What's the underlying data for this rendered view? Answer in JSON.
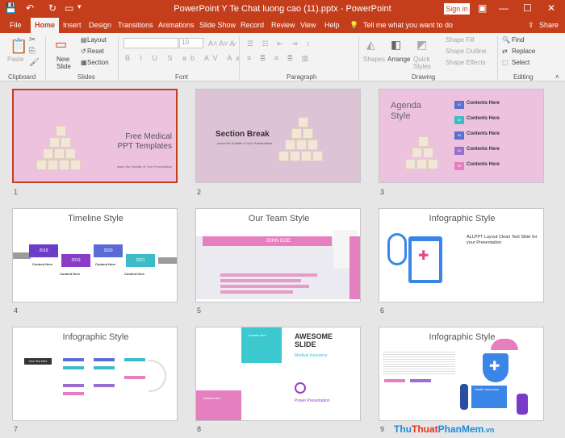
{
  "window": {
    "title": "PowerPoint Y Te Chat luong cao (11).pptx - PowerPoint",
    "sign_in": "Sign in",
    "share": "Share",
    "tell_me": "Tell me what you want to do"
  },
  "tabs": [
    "File",
    "Home",
    "Insert",
    "Design",
    "Transitions",
    "Animations",
    "Slide Show",
    "Record",
    "Review",
    "View",
    "Help"
  ],
  "ribbon": {
    "clipboard": {
      "label": "Clipboard",
      "paste": "Paste"
    },
    "slides": {
      "label": "Slides",
      "new_slide": "New Slide",
      "layout": "Layout",
      "reset": "Reset",
      "section": "Section"
    },
    "font": {
      "label": "Font",
      "size": "10"
    },
    "paragraph": {
      "label": "Paragraph"
    },
    "drawing": {
      "label": "Drawing",
      "shapes": "Shapes",
      "arrange": "Arrange",
      "quick_styles": "Quick Styles",
      "shape_fill": "Shape Fill",
      "shape_outline": "Shape Outline",
      "shape_effects": "Shape Effects"
    },
    "editing": {
      "label": "Editing",
      "find": "Find",
      "replace": "Replace",
      "select": "Select"
    }
  },
  "slides": [
    {
      "num": "1",
      "title": "Free Medical PPT Templates",
      "subtitle": "Insert the Subtitle of Your Presentation"
    },
    {
      "num": "2",
      "title": "Section Break",
      "subtitle": "Insert the Subtitle of Your Presentation"
    },
    {
      "num": "3",
      "title": "Agenda Style",
      "item": "Contents Here",
      "item_numbers": [
        "01",
        "02",
        "03",
        "04",
        "05"
      ]
    },
    {
      "num": "4",
      "title": "Timeline Style",
      "item": "Content Here",
      "years": [
        "2018",
        "2019",
        "2020",
        "2021"
      ]
    },
    {
      "num": "5",
      "title": "Our Team Style",
      "name": "JOHN DOE"
    },
    {
      "num": "6",
      "title": "Infographic Style",
      "heading": "ALLPPT Layout Clean Text Slide for your Presentation"
    },
    {
      "num": "7",
      "title": "Infographic Style",
      "root": "Your Text Here"
    },
    {
      "num": "8",
      "title": "AWESOME SLIDE",
      "subtitle": "Medical Insurance",
      "footer": "Power Presentation",
      "box": "Contents Here"
    },
    {
      "num": "9",
      "title": "Infographic Style",
      "badge": "Health Insurance"
    }
  ],
  "watermark": {
    "blue1": "Thu",
    "red": "Thuat",
    "blue2": "PhanMem",
    "suffix": ".vn"
  },
  "colors": {
    "accent": "#c43e1c",
    "pink": "#e67fbf",
    "purple": "#7a3cc8",
    "teal": "#3bbcc8"
  }
}
